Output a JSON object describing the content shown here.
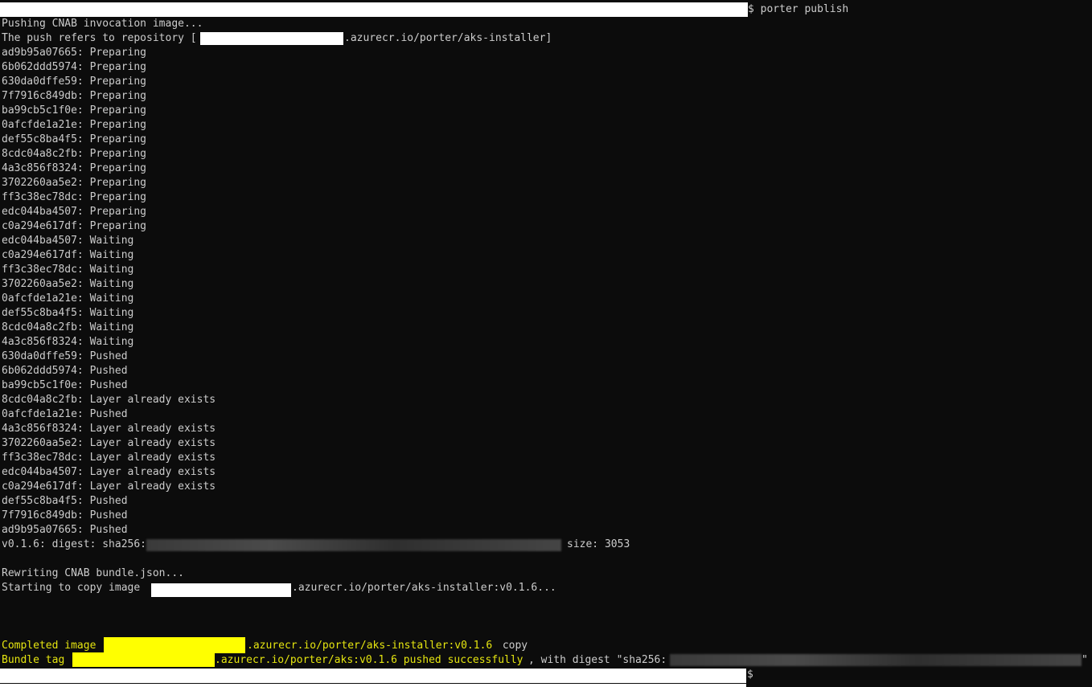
{
  "prompt": {
    "command": "$ porter publish",
    "trailing_prompt": "$"
  },
  "lines": [
    "Pushing CNAB invocation image...",
    "The push refers to repository [",
    "ad9b95a07665: Preparing",
    "6b062ddd5974: Preparing",
    "630da0dffe59: Preparing",
    "7f7916c849db: Preparing",
    "ba99cb5c1f0e: Preparing",
    "0afcfde1a21e: Preparing",
    "def55c8ba4f5: Preparing",
    "8cdc04a8c2fb: Preparing",
    "4a3c856f8324: Preparing",
    "3702260aa5e2: Preparing",
    "ff3c38ec78dc: Preparing",
    "edc044ba4507: Preparing",
    "c0a294e617df: Preparing",
    "edc044ba4507: Waiting",
    "c0a294e617df: Waiting",
    "ff3c38ec78dc: Waiting",
    "3702260aa5e2: Waiting",
    "0afcfde1a21e: Waiting",
    "def55c8ba4f5: Waiting",
    "8cdc04a8c2fb: Waiting",
    "4a3c856f8324: Waiting",
    "630da0dffe59: Pushed",
    "6b062ddd5974: Pushed",
    "ba99cb5c1f0e: Pushed",
    "8cdc04a8c2fb: Layer already exists",
    "0afcfde1a21e: Pushed",
    "4a3c856f8324: Layer already exists",
    "3702260aa5e2: Layer already exists",
    "ff3c38ec78dc: Layer already exists",
    "edc044ba4507: Layer already exists",
    "c0a294e617df: Layer already exists",
    "def55c8ba4f5: Pushed",
    "7f7916c849db: Pushed",
    "ad9b95a07665: Pushed"
  ],
  "repo_suffix": ".azurecr.io/porter/aks-installer]",
  "digest": {
    "prefix": "v0.1.6: digest: sha256:",
    "size": "size: 3053"
  },
  "rewriting": "Rewriting CNAB bundle.json...",
  "copy": {
    "prefix": "Starting to copy image ",
    "suffix": ".azurecr.io/porter/aks-installer:v0.1.6..."
  },
  "completed": {
    "prefix": "Completed image ",
    "suffix": ".azurecr.io/porter/aks-installer:v0.1.6",
    "tail": " copy"
  },
  "bundle_tag": {
    "prefix": "Bundle tag ",
    "middle": ".azurecr.io/porter/aks:v0.1.6 pushed successfully",
    "tail": ", with digest \"sha256:",
    "end": "\""
  },
  "colors": {
    "background": "#0c0c0c",
    "text": "#cccccc",
    "highlight_yellow": "#e5e510",
    "redaction_white": "#ffffff",
    "redaction_yellow": "#ffff00"
  }
}
